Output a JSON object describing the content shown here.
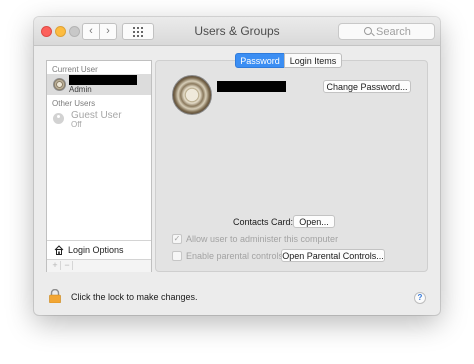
{
  "window": {
    "title": "Users & Groups",
    "search_placeholder": "Search",
    "nav": {
      "back_glyph": "‹",
      "forward_glyph": "›"
    },
    "traffic_lights": {
      "close": "#fc605b",
      "minimize": "#fdbc40",
      "zoom": "#c8c8c8"
    }
  },
  "sidebar": {
    "current_user_label": "Current User",
    "current_user": {
      "role": "Admin"
    },
    "other_users_label": "Other Users",
    "guest_user": {
      "name": "Guest User",
      "status": "Off"
    },
    "login_options_label": "Login Options",
    "add_glyph": "+",
    "remove_glyph": "−"
  },
  "tabs": [
    {
      "label": "Password",
      "active": true
    },
    {
      "label": "Login Items",
      "active": false
    }
  ],
  "main": {
    "change_password_button": "Change Password...",
    "contacts_card_label": "Contacts Card:",
    "open_button": "Open...",
    "allow_admin_label": "Allow user to administer this computer",
    "allow_admin_checked": true,
    "parental_controls_label": "Enable parental controls",
    "parental_controls_checked": false,
    "open_parental_button": "Open Parental Controls..."
  },
  "footer": {
    "lock_text": "Click the lock to make changes.",
    "help_glyph": "?"
  },
  "colors": {
    "accent": "#3b8ef3",
    "lock_body": "#f2a634"
  }
}
